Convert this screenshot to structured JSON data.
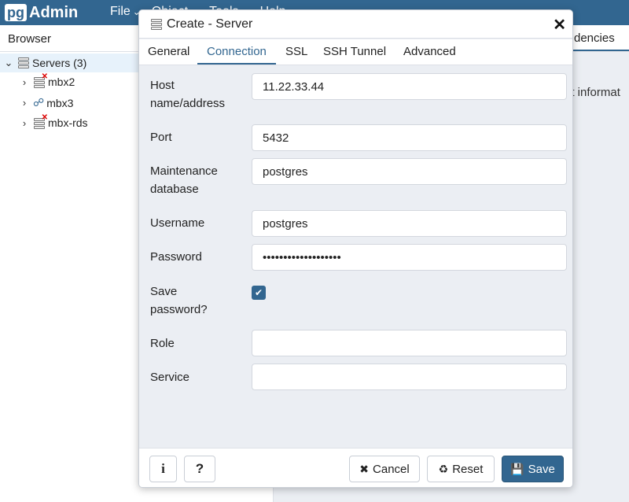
{
  "navbar": {
    "logo_pg": "pg",
    "logo_admin": "Admin",
    "menus": [
      "File",
      "Object",
      "Tools",
      "Help"
    ]
  },
  "browser": {
    "header": "Browser",
    "root_label": "Servers",
    "root_count": "(3)",
    "servers": [
      {
        "name": "mbx2",
        "icon": "server-disconnected-icon"
      },
      {
        "name": "mbx3",
        "icon": "postgres-elephant-icon"
      },
      {
        "name": "mbx-rds",
        "icon": "server-disconnected-icon"
      }
    ]
  },
  "right_panel": {
    "tab_label": "dencies",
    "info_text": "nt informat"
  },
  "dialog": {
    "title": "Create - Server",
    "tabs": [
      "General",
      "Connection",
      "SSL",
      "SSH Tunnel",
      "Advanced"
    ],
    "active_tab": "Connection",
    "fields": {
      "host_label_line1": "Host",
      "host_label_line2": "name/address",
      "host_value": "11.22.33.44",
      "port_label": "Port",
      "port_value": "5432",
      "maint_label_line1": "Maintenance",
      "maint_label_line2": "database",
      "maint_value": "postgres",
      "username_label": "Username",
      "username_value": "postgres",
      "password_label": "Password",
      "password_value": "•••••••••••••••••••",
      "save_pw_label_line1": "Save",
      "save_pw_label_line2": "password?",
      "save_pw_checked": true,
      "role_label": "Role",
      "role_value": "",
      "service_label": "Service",
      "service_value": ""
    },
    "footer": {
      "info_label": "i",
      "help_label": "?",
      "cancel_label": "Cancel",
      "reset_label": "Reset",
      "save_label": "Save"
    }
  },
  "colors": {
    "brand": "#326690",
    "dialog_bg": "#ebeef3"
  }
}
